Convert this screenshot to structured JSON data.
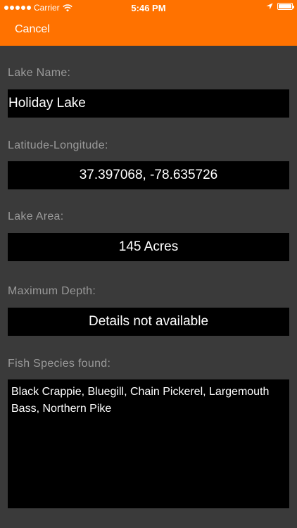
{
  "status_bar": {
    "carrier": "Carrier",
    "time": "5:46 PM",
    "wifi_icon": "wifi-icon",
    "location_icon": "location-arrow-icon",
    "battery_icon": "battery-icon"
  },
  "nav": {
    "cancel_label": "Cancel",
    "bar_color": "#ff7200"
  },
  "form": {
    "lake_name_label": "Lake Name:",
    "lake_name_value": "Holiday Lake",
    "latlng_label": "Latitude-Longitude:",
    "latlng_value": "37.397068, -78.635726",
    "area_label": "Lake Area:",
    "area_value": "145 Acres",
    "depth_label": "Maximum Depth:",
    "depth_value": "Details not available",
    "species_label": "Fish Species found:",
    "species_value": "Black Crappie, Bluegill, Chain Pickerel, Largemouth Bass, Northern Pike"
  }
}
